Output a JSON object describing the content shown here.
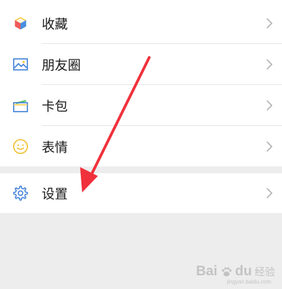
{
  "menu": {
    "items": [
      {
        "label": "收藏",
        "icon": "favorites-cube-icon"
      },
      {
        "label": "朋友圈",
        "icon": "moments-image-icon"
      },
      {
        "label": "卡包",
        "icon": "card-wallet-icon"
      },
      {
        "label": "表情",
        "icon": "sticker-smiley-icon"
      }
    ],
    "settings": {
      "label": "设置",
      "icon": "gear-icon"
    }
  },
  "annotation": {
    "arrow_color": "#f0313b"
  },
  "watermark": {
    "logo": "Bai",
    "logo_suffix": "du",
    "brand": "经验",
    "url": "jingyan.baidu.com"
  },
  "colors": {
    "background": "#ededed",
    "row": "#ffffff",
    "text": "#1a1a1a",
    "divider": "#e5e5e5",
    "chevron": "#b2b2b2",
    "icon_blue": "#3b7dd8"
  }
}
